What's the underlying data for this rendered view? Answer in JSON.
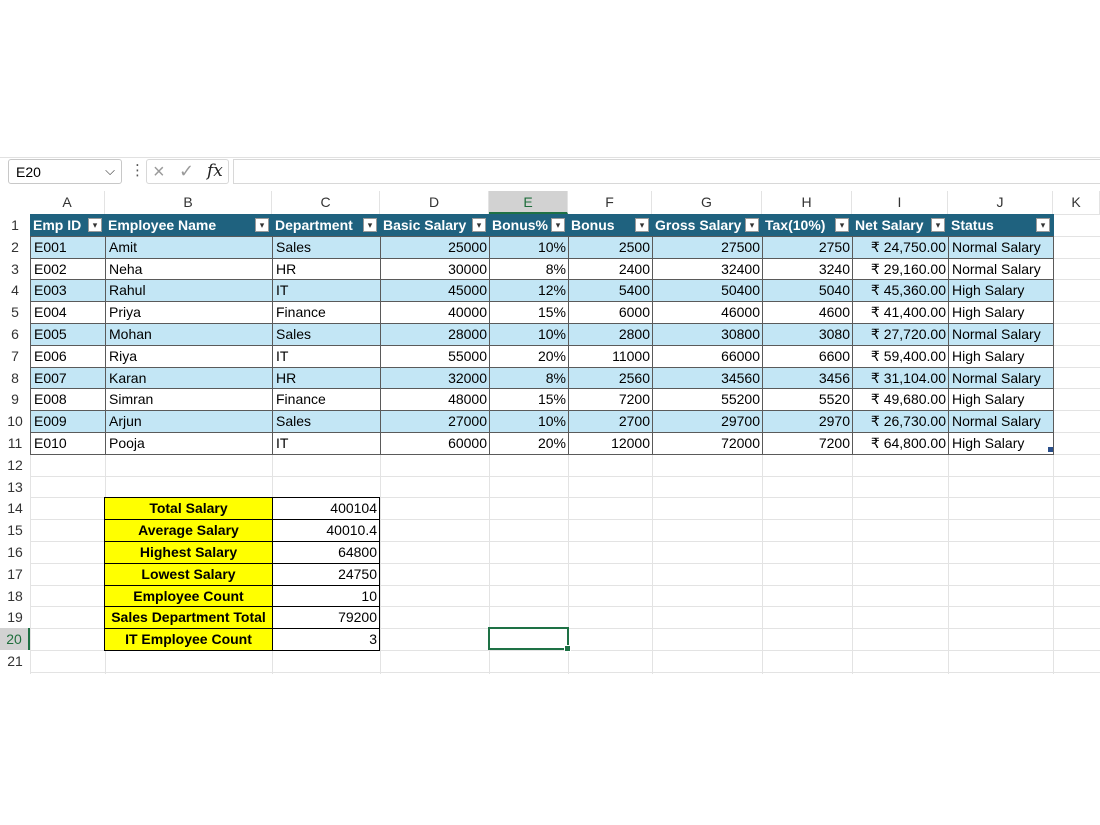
{
  "formula_bar": {
    "name_box": "E20",
    "cancel_icon": "×",
    "enter_icon": "✓",
    "fx_label": "fx",
    "formula": ""
  },
  "columns": [
    "A",
    "B",
    "C",
    "D",
    "E",
    "F",
    "G",
    "H",
    "I",
    "J",
    "K"
  ],
  "rows": [
    "1",
    "2",
    "3",
    "4",
    "5",
    "6",
    "7",
    "8",
    "9",
    "10",
    "11",
    "12",
    "13",
    "14",
    "15",
    "16",
    "17",
    "18",
    "19",
    "20",
    "21"
  ],
  "table": {
    "headers": [
      "Emp ID",
      "Employee Name",
      "Department",
      "Basic Salary",
      "Bonus%",
      "Bonus",
      "Gross Salary",
      "Tax(10%)",
      "Net Salary",
      "Status"
    ],
    "rows": [
      [
        "E001",
        "Amit",
        "Sales",
        "25000",
        "10%",
        "2500",
        "27500",
        "2750",
        "₹ 24,750.00",
        "Normal Salary"
      ],
      [
        "E002",
        "Neha",
        "HR",
        "30000",
        "8%",
        "2400",
        "32400",
        "3240",
        "₹ 29,160.00",
        "Normal Salary"
      ],
      [
        "E003",
        "Rahul",
        "IT",
        "45000",
        "12%",
        "5400",
        "50400",
        "5040",
        "₹ 45,360.00",
        "High Salary"
      ],
      [
        "E004",
        "Priya",
        "Finance",
        "40000",
        "15%",
        "6000",
        "46000",
        "4600",
        "₹ 41,400.00",
        "High Salary"
      ],
      [
        "E005",
        "Mohan",
        "Sales",
        "28000",
        "10%",
        "2800",
        "30800",
        "3080",
        "₹ 27,720.00",
        "Normal Salary"
      ],
      [
        "E006",
        "Riya",
        "IT",
        "55000",
        "20%",
        "11000",
        "66000",
        "6600",
        "₹ 59,400.00",
        "High Salary"
      ],
      [
        "E007",
        "Karan",
        "HR",
        "32000",
        "8%",
        "2560",
        "34560",
        "3456",
        "₹ 31,104.00",
        "Normal Salary"
      ],
      [
        "E008",
        "Simran",
        "Finance",
        "48000",
        "15%",
        "7200",
        "55200",
        "5520",
        "₹ 49,680.00",
        "High Salary"
      ],
      [
        "E009",
        "Arjun",
        "Sales",
        "27000",
        "10%",
        "2700",
        "29700",
        "2970",
        "₹ 26,730.00",
        "Normal Salary"
      ],
      [
        "E010",
        "Pooja",
        "IT",
        "60000",
        "20%",
        "12000",
        "72000",
        "7200",
        "₹ 64,800.00",
        "High Salary"
      ]
    ]
  },
  "summary": [
    {
      "label": "Total Salary",
      "value": "400104"
    },
    {
      "label": "Average Salary",
      "value": "40010.4"
    },
    {
      "label": "Highest Salary",
      "value": "64800"
    },
    {
      "label": "Lowest Salary",
      "value": "24750"
    },
    {
      "label": "Employee Count",
      "value": "10"
    },
    {
      "label": "Sales Department Total",
      "value": "79200"
    },
    {
      "label": "IT Employee Count",
      "value": "3"
    }
  ],
  "selected_cell": "E20",
  "colors": {
    "header_fill": "#1f627f",
    "band_fill": "#c3e6f5",
    "summary_label_fill": "#ffff00",
    "selection": "#1e7145"
  }
}
